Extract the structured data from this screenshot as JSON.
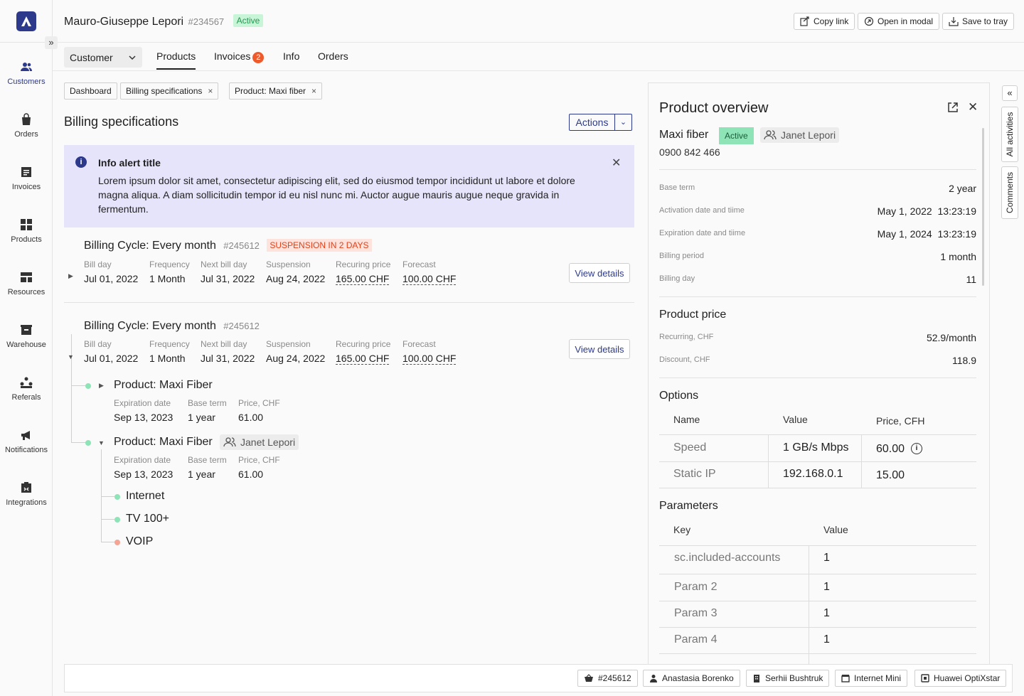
{
  "customer": {
    "name": "Mauro-Giuseppe Lepori",
    "id": "#234567",
    "status": "Active"
  },
  "header_actions": {
    "copy_link": "Copy link",
    "open_modal": "Open in modal",
    "save_tray": "Save to tray"
  },
  "sidebar": {
    "items": [
      {
        "label": "Customers",
        "icon": "users-icon"
      },
      {
        "label": "Orders",
        "icon": "shopping-bag-icon"
      },
      {
        "label": "Invoices",
        "icon": "invoice-icon"
      },
      {
        "label": "Products",
        "icon": "grid-icon"
      },
      {
        "label": "Resources",
        "icon": "resources-icon"
      },
      {
        "label": "Warehouse",
        "icon": "warehouse-icon"
      },
      {
        "label": "Referals",
        "icon": "referals-icon"
      },
      {
        "label": "Notifications",
        "icon": "megaphone-icon"
      },
      {
        "label": "Integrations",
        "icon": "integrations-icon"
      }
    ]
  },
  "tabs": {
    "selector": "Customer",
    "products": "Products",
    "invoices": "Invoices",
    "invoices_count": "2",
    "info": "Info",
    "orders": "Orders"
  },
  "breadcrumbs": {
    "dashboard": "Dashboard",
    "billing": "Billing specifications",
    "product": "Product: Maxi fiber"
  },
  "page": {
    "title": "Billing specifications",
    "actions": "Actions"
  },
  "alert": {
    "title": "Info alert title",
    "body": "Lorem ipsum dolor sit amet, consectetur adipiscing elit, sed do eiusmod tempor incididunt ut labore et dolore magna aliqua. A diam sollicitudin tempor id eu nisl nunc mi. Auctor augue mauris augue neque gravida in fermentum."
  },
  "field_labels": {
    "bill_day": "Bill day",
    "frequency": "Frequency",
    "next_bill_day": "Next bill day",
    "suspension": "Suspension",
    "recurring": "Recuring price",
    "forecast": "Forecast",
    "expiration": "Expiration date",
    "base_term": "Base term",
    "price": "Price, CHF"
  },
  "cycles": [
    {
      "title": "Billing Cycle: Every month",
      "id": "#245612",
      "badge": "SUSPENSION IN 2 DAYS",
      "bill_day": "Jul 01, 2022",
      "frequency": "1 Month",
      "next_bill_day": "Jul 31, 2022",
      "suspension": "Aug 24, 2022",
      "recurring": "165.00 CHF",
      "forecast": "100.00 CHF",
      "view": "View details"
    },
    {
      "title": "Billing Cycle: Every month",
      "id": "#245612",
      "bill_day": "Jul 01, 2022",
      "frequency": "1 Month",
      "next_bill_day": "Jul 31, 2022",
      "suspension": "Aug 24, 2022",
      "recurring": "165.00 CHF",
      "forecast": "100.00 CHF",
      "view": "View details"
    }
  ],
  "products": [
    {
      "title": "Product: Maxi Fiber",
      "expiration": "Sep 13, 2023",
      "base_term": "1 year",
      "price": "61.00"
    },
    {
      "title": "Product: Maxi Fiber",
      "person": "Janet Lepori",
      "expiration": "Sep 13, 2023",
      "base_term": "1 year",
      "price": "61.00"
    }
  ],
  "services": [
    {
      "name": "Internet",
      "status_color": "#8ee3b7"
    },
    {
      "name": "TV 100+",
      "status_color": "#8ee3b7"
    },
    {
      "name": "VOIP",
      "status_color": "#f4a493"
    }
  ],
  "overview": {
    "title": "Product overview",
    "product": "Maxi fiber",
    "status": "Active",
    "person": "Janet Lepori",
    "phone": "0900 842 466",
    "rows": [
      {
        "label": "Base term",
        "value": "2 year"
      },
      {
        "label": "Activation date and tiime",
        "value": "May 1, 2022  13:23:19"
      },
      {
        "label": "Expiration date and tiime",
        "value": "May 1, 2024  13:23:19"
      },
      {
        "label": "Billing period",
        "value": "1 month"
      },
      {
        "label": "Billing day",
        "value": "11"
      }
    ],
    "price_title": "Product price",
    "prices": [
      {
        "label": "Recurring, CHF",
        "value": "52.9/month"
      },
      {
        "label": "Discount, CHF",
        "value": "118.9"
      }
    ],
    "options_title": "Options",
    "options_head": {
      "name": "Name",
      "value": "Value",
      "price": "Price, CFH"
    },
    "options": [
      {
        "name": "Speed",
        "value": "1 GB/s Mbps",
        "price": "60.00"
      },
      {
        "name": "Static IP",
        "value": "192.168.0.1",
        "price": "15.00"
      }
    ],
    "params_title": "Parameters",
    "params_head": {
      "key": "Key",
      "value": "Value"
    },
    "params": [
      {
        "key": "sc.included-accounts",
        "value": "1"
      },
      {
        "key": "Param 2",
        "value": "1"
      },
      {
        "key": "Param 3",
        "value": "1"
      },
      {
        "key": "Param 4",
        "value": "1"
      }
    ]
  },
  "rail": {
    "activities": "All activities",
    "comments": "Comments"
  },
  "footer_chips": [
    {
      "label": "#245612",
      "icon": "basket-icon"
    },
    {
      "label": "Anastasia Borenko",
      "icon": "person-icon"
    },
    {
      "label": "Serhii Bushtruk",
      "icon": "building-icon"
    },
    {
      "label": "Internet Mini",
      "icon": "box-icon"
    },
    {
      "label": "Huawei OptiXstar",
      "icon": "device-icon"
    }
  ],
  "colors": {
    "brand": "#2d3a8c",
    "active_bg": "#c8f5d7",
    "alert_bg": "#e6e4fb",
    "danger": "#e2411a"
  }
}
